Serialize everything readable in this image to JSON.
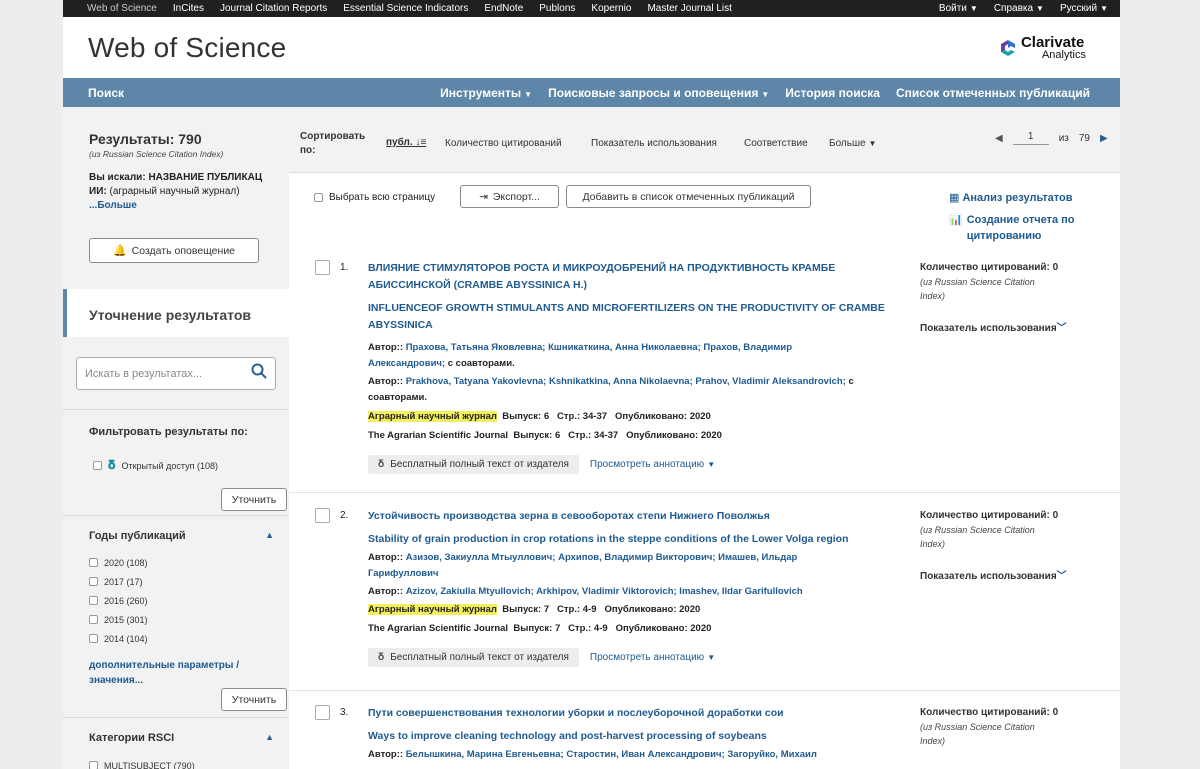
{
  "topbar": {
    "links": [
      "Web of Science",
      "InCites",
      "Journal Citation Reports",
      "Essential Science Indicators",
      "EndNote",
      "Publons",
      "Kopernio",
      "Master Journal List"
    ],
    "right": [
      "Войти",
      "Справка",
      "Русский"
    ]
  },
  "header": {
    "title": "Web of Science",
    "logo_line1": "Clarivate",
    "logo_line2": "Analytics"
  },
  "nav": {
    "search": "Поиск",
    "items": [
      "Инструменты",
      "Поисковые запросы и оповещения",
      "История поиска",
      "Список отмеченных публикаций"
    ]
  },
  "sidebar": {
    "results_label": "Результаты: 790",
    "results_source": "(из Russian Science Citation Index)",
    "searched_prefix": "Вы искали:",
    "searched_value": "НАЗВАНИЕ ПУБЛИКАЦ",
    "searched_line2": "ИИ:",
    "searched_line2b": "(аграрный научный журнал)",
    "more": "...Больше",
    "create_alert": "Создать оповещение",
    "refine_title": "Уточнение результатов",
    "search_placeholder": "Искать в результатах...",
    "filter_title": "Фильтровать результаты по:",
    "open_access": "Открытый доступ (108)",
    "refine_btn": "Уточнить",
    "years_title": "Годы публикаций",
    "years": [
      "2020 (108)",
      "2017 (17)",
      "2016 (260)",
      "2015 (301)",
      "2014 (104)"
    ],
    "more_options": "дополнительные параметры /",
    "more_options2": "значения...",
    "rsci_title": "Категории RSCI",
    "rsci_first": "MULTISUBJECT (790)"
  },
  "sortbar": {
    "sort_label": "Сортировать",
    "sort_label2": "по:",
    "options": [
      "публ.",
      "Количество цитирований",
      "Показатель использования",
      "Соответствие",
      "Больше"
    ],
    "page_current": "1",
    "page_of": "из",
    "page_total": "79"
  },
  "toolbar": {
    "select_page": "Выбрать всю страницу",
    "export": "Экспорт...",
    "add_marked": "Добавить в список отмеченных публикаций",
    "analyze": "Анализ результатов",
    "citation_report": "Создание отчета по",
    "citation_report2": "цитированию"
  },
  "results": [
    {
      "num": "1.",
      "title_ru_1": "ВЛИЯНИЕ СТИМУЛЯТОРОВ РОСТА И МИКРОУДОБРЕНИЙ НА ПРОДУКТИВНОСТЬ КРАМБЕ",
      "title_ru_2": "АБИССИНСКОЙ (CRAMBE ABYSSINICA H.)",
      "title_en_1": "INFLUENCEOF GROWTH STIMULANTS AND MICROFERTILIZERS ON THE PRODUCTIVITY OF CRAMBE",
      "title_en_2": "ABYSSINICA",
      "authors_ru_1": "Прахова, Татьяна Яковлевна; Кшникаткина, Анна Николаевна; Прахов, Владимир",
      "authors_ru_2": "Александрович;",
      "authors_ru_tail": " с соавторами.",
      "authors_en_1": "Prakhova, Tatyana Yakovlevna; Kshnikatkina, Anna Nikolaevna; Prahov, Vladimir Aleksandrovich;",
      "authors_en_tail1": " с",
      "authors_en_2": "соавторами.",
      "journal_ru": "Аграрный научный журнал",
      "issue_ru": "Выпуск: 6   Стр.: 34-37   Опубликовано: 2020",
      "journal_en": "The Agrarian Scientific Journal",
      "issue_en": "Выпуск: 6   Стр.: 34-37   Опубликовано: 2020",
      "cites": "Количество цитирований: 0",
      "cites_src1": "(из Russian Science Citation",
      "cites_src2": "Index)",
      "usage": "Показатель использования"
    },
    {
      "num": "2.",
      "title_ru_1": "Устойчивость производства зерна в севооборотах степи Нижнего Поволжья",
      "title_en_1": "Stability of grain production in crop rotations in the steppe conditions of the Lower Volga region",
      "authors_ru_1": "Азизов, Закиулла Мтыуллович; Архипов, Владимир Викторович; Имашев, Ильдар",
      "authors_ru_2": "Гарифуллович",
      "authors_en_1": "Azizov, Zakiulla Mtyullovich; Arkhipov, Vladimir Viktorovich; Imashev, Ildar Garifullovich",
      "journal_ru": "Аграрный научный журнал",
      "issue_ru": "Выпуск: 7   Стр.: 4-9   Опубликовано: 2020",
      "journal_en": "The Agrarian Scientific Journal",
      "issue_en": "Выпуск: 7   Стр.: 4-9   Опубликовано: 2020",
      "cites": "Количество цитирований: 0",
      "cites_src1": "(из Russian Science Citation",
      "cites_src2": "Index)",
      "usage": "Показатель использования"
    },
    {
      "num": "3.",
      "title_ru_1": "Пути совершенствования технологии уборки и послеуборочной доработки сои",
      "title_en_1": "Ways to improve cleaning technology and post-harvest processing of soybeans",
      "authors_ru_1": "Белышкина, Марина Евгеньевна; Старостин, Иван Александрович; Загоруйко, Михаил",
      "cites": "Количество цитирований: 0",
      "cites_src1": "(из Russian Science Citation",
      "cites_src2": "Index)"
    }
  ],
  "common": {
    "author_label": "Автор::",
    "fulltext": "Бесплатный полный текст от издателя",
    "abstract": "Просмотреть аннотацию"
  },
  "colors": {
    "nav": "#5e86a9",
    "link": "#1f5a90",
    "highlight": "#f4ef5c",
    "topbar": "#202020"
  }
}
